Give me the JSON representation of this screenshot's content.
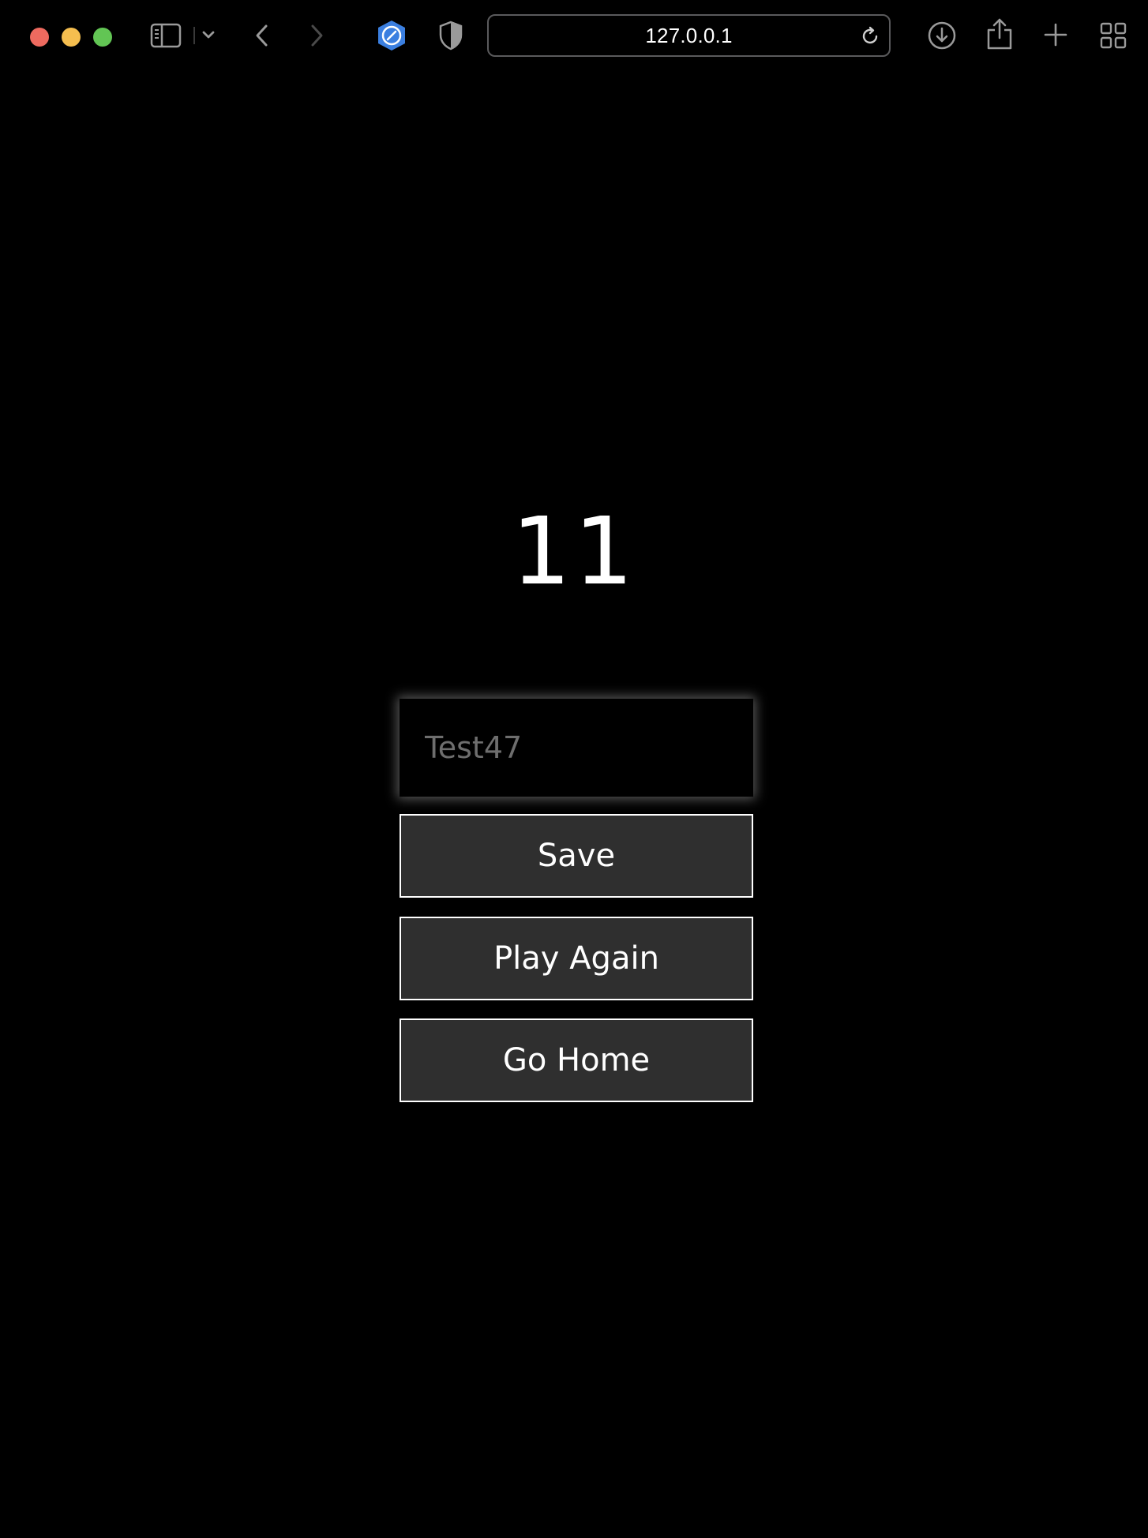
{
  "browser": {
    "url": "127.0.0.1",
    "traffic_lights": {
      "close_color": "#ee6a5f",
      "minimize_color": "#f5be4f",
      "maximize_color": "#62c554"
    },
    "accent_color": "#3b7fe0",
    "icons": [
      "sidebar-icon",
      "chevron-down-icon",
      "back-icon",
      "forward-icon",
      "compass-shield-icon",
      "privacy-shield-icon",
      "reload-icon",
      "download-icon",
      "share-icon",
      "plus-icon",
      "tab-overview-icon"
    ]
  },
  "game_over": {
    "score": "11",
    "name_input": {
      "value": "",
      "placeholder": "Test47"
    },
    "buttons": {
      "save": "Save",
      "play_again": "Play Again",
      "go_home": "Go Home"
    }
  }
}
